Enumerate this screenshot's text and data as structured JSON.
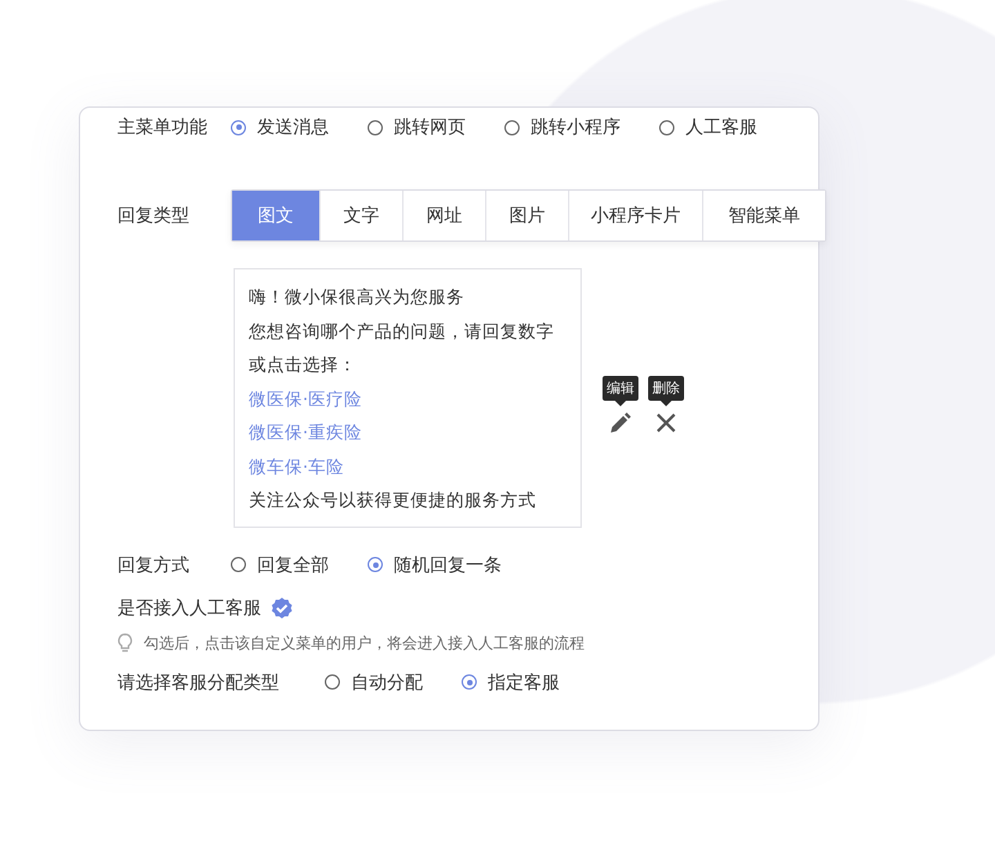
{
  "menu_function": {
    "label": "主菜单功能",
    "options": [
      {
        "label": "发送消息",
        "selected": true
      },
      {
        "label": "跳转网页",
        "selected": false
      },
      {
        "label": "跳转小程序",
        "selected": false
      },
      {
        "label": "人工客服",
        "selected": false
      }
    ]
  },
  "reply_type": {
    "label": "回复类型",
    "tabs": [
      {
        "label": "图文",
        "selected": true
      },
      {
        "label": "文字",
        "selected": false
      },
      {
        "label": "网址",
        "selected": false
      },
      {
        "label": "图片",
        "selected": false
      },
      {
        "label": "小程序卡片",
        "selected": false
      },
      {
        "label": "智能菜单",
        "selected": false
      }
    ]
  },
  "message": {
    "lines": [
      {
        "kind": "text",
        "text": "嗨！微小保很高兴为您服务"
      },
      {
        "kind": "text",
        "text": "您想咨询哪个产品的问题，请回复数字"
      },
      {
        "kind": "text",
        "text": "或点击选择："
      },
      {
        "kind": "link",
        "text": "微医保·医疗险"
      },
      {
        "kind": "link",
        "text": "微医保·重疾险"
      },
      {
        "kind": "link",
        "text": "微车保·车险"
      },
      {
        "kind": "text",
        "text": "关注公众号以获得更便捷的服务方式"
      }
    ],
    "actions": [
      {
        "kind": "edit",
        "tooltip": "编辑"
      },
      {
        "kind": "delete",
        "tooltip": "删除"
      }
    ]
  },
  "reply_mode": {
    "label": "回复方式",
    "options": [
      {
        "label": "回复全部",
        "selected": false
      },
      {
        "label": "随机回复一条",
        "selected": true
      }
    ]
  },
  "human_service": {
    "label": "是否接入人工客服",
    "checked": true,
    "hint": "勾选后，点击该自定义菜单的用户，将会进入接入人工客服的流程"
  },
  "assign_type": {
    "label": "请选择客服分配类型",
    "options": [
      {
        "label": "自动分配",
        "selected": false
      },
      {
        "label": "指定客服",
        "selected": true
      }
    ]
  }
}
